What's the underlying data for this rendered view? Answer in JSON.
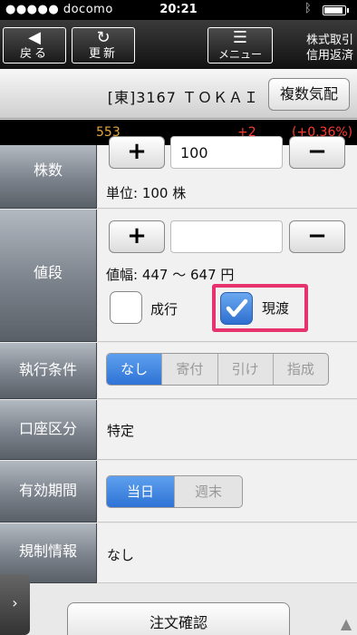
{
  "status": {
    "carrier": "●●●●● docomo",
    "time": "20:21"
  },
  "toolbar": {
    "back": {
      "icon": "◀",
      "label": "戻る"
    },
    "refresh": {
      "icon": "↻",
      "label": "更新"
    },
    "menu": {
      "icon": "☰",
      "label": "メニュー"
    },
    "trade_line1": "株式取引",
    "trade_line2": "信用返済"
  },
  "stock": {
    "name": "[東]3167 ＴＯＫＡＩ",
    "depth_button": "複数気配"
  },
  "price": {
    "last": "553",
    "change": "+2",
    "change_pct": "(+0.36%)"
  },
  "quantity": {
    "label": "株数",
    "value": "100",
    "unit": "単位: 100 株"
  },
  "price_section": {
    "label": "値段",
    "value": "",
    "range": "値幅: 447 〜 647 円",
    "market_label": "成行",
    "current_label": "現渡",
    "market_checked": false,
    "current_checked": true
  },
  "condition": {
    "label": "執行条件",
    "options": [
      "なし",
      "寄付",
      "引け",
      "指成"
    ],
    "selected": 0
  },
  "account": {
    "label": "口座区分",
    "value": "特定"
  },
  "period": {
    "label": "有効期間",
    "options": [
      "当日",
      "週末"
    ],
    "selected": 0
  },
  "regulation": {
    "label": "規制情報",
    "value": "なし"
  },
  "confirm_button": "注文確認",
  "colors": {
    "accent_blue": "#2e73d6",
    "price_last": "#e8a640",
    "price_change": "#ff3b30",
    "highlight": "#e6336d"
  }
}
